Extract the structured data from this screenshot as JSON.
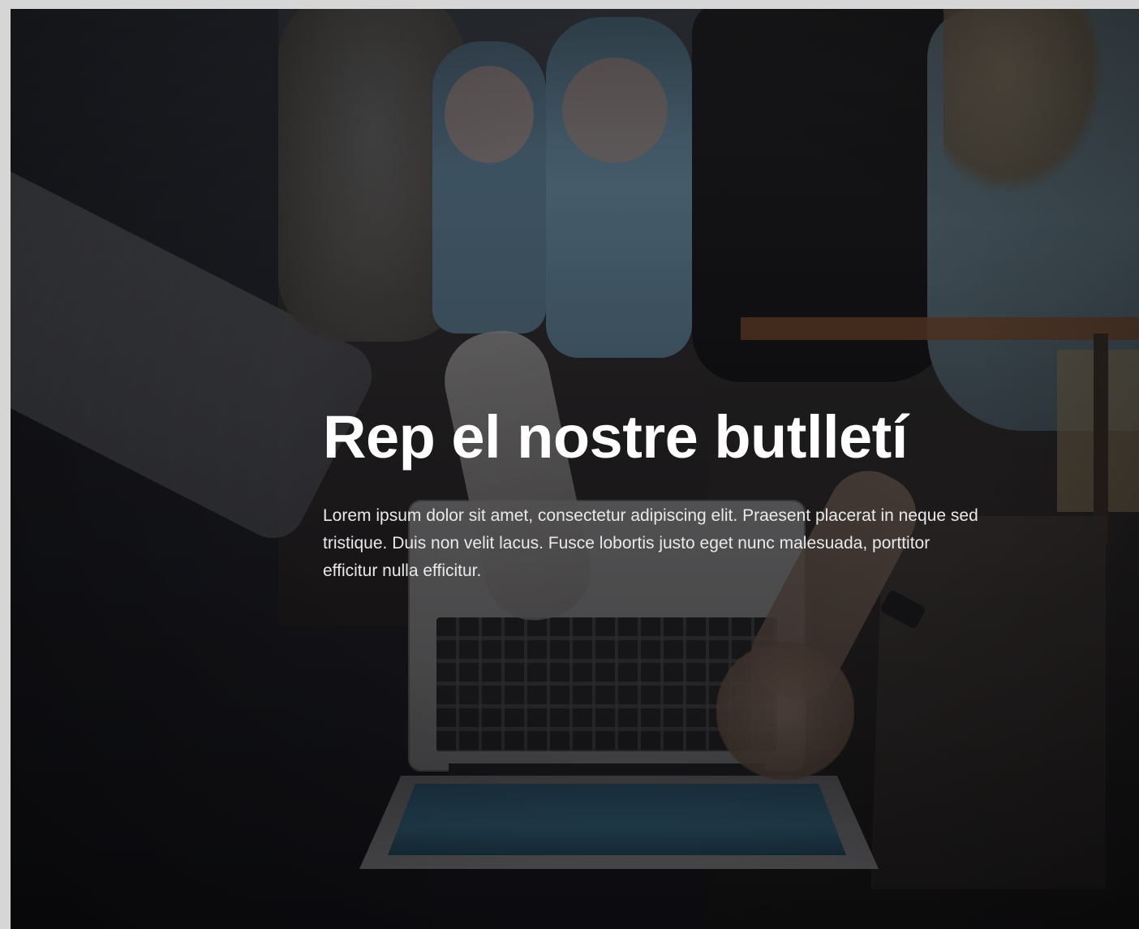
{
  "hero": {
    "title": "Rep el nostre butlletí",
    "description": "Lorem ipsum dolor sit amet, consectetur adipiscing elit. Praesent placerat in neque sed tristique. Duis non velit lacus. Fusce lobortis justo eget nunc malesuada, porttitor efficitur nulla efficitur."
  },
  "colors": {
    "page_background": "#d6d6d6",
    "hero_dark": "#16151a",
    "text": "#ffffff"
  }
}
